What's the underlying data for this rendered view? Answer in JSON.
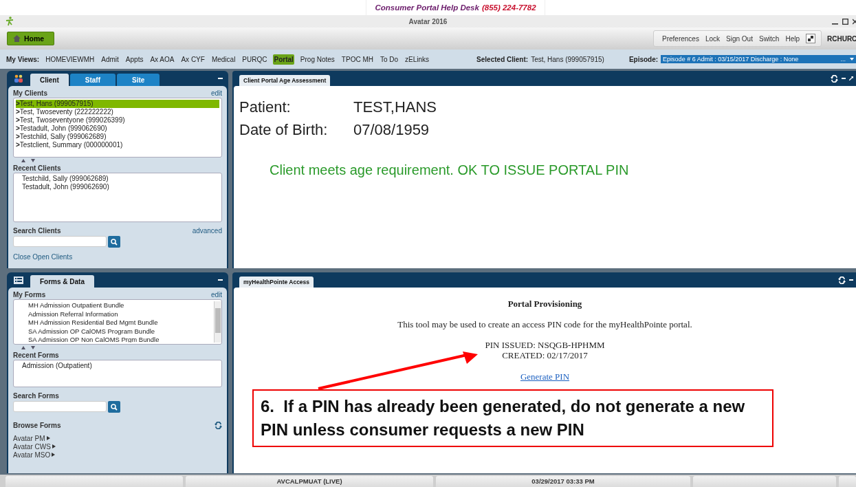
{
  "help_banner": {
    "label": "Consumer Portal Help Desk",
    "phone": "(855) 224-7782"
  },
  "window": {
    "title": "Avatar 2016"
  },
  "toolbar": {
    "home": "Home",
    "links": [
      "Preferences",
      "Lock",
      "Sign Out",
      "Switch",
      "Help"
    ],
    "user": "RCHURC"
  },
  "views_bar": {
    "label": "My Views:",
    "views": [
      {
        "label": "HOMEVIEWMH",
        "selected": false
      },
      {
        "label": "Admit",
        "selected": false
      },
      {
        "label": "Appts",
        "selected": false
      },
      {
        "label": "Ax AOA",
        "selected": false
      },
      {
        "label": "Ax CYF",
        "selected": false
      },
      {
        "label": "Medical",
        "selected": false
      },
      {
        "label": "PURQC",
        "selected": false
      },
      {
        "label": "Portal",
        "selected": true
      },
      {
        "label": "Prog Notes",
        "selected": false
      },
      {
        "label": "TPOC MH",
        "selected": false
      },
      {
        "label": "To Do",
        "selected": false
      },
      {
        "label": "zELinks",
        "selected": false
      }
    ],
    "selected_client_label": "Selected Client:",
    "selected_client": "Test, Hans (999057915)",
    "episode_label": "Episode:",
    "episode": "Episode # 6 Admit : 03/15/2017 Discharge : None",
    "episode_more": "..."
  },
  "client_panel": {
    "tabs": [
      {
        "label": "Client",
        "selected": true
      },
      {
        "label": "Staff",
        "selected": false
      },
      {
        "label": "Site",
        "selected": false
      }
    ],
    "my_clients": {
      "title": "My Clients",
      "edit": "edit",
      "items": [
        {
          "label": "**>**Test, Hans (999057915)",
          "selected": true
        },
        {
          "label": "**>**Test, Twoseventy (222222222)",
          "selected": false
        },
        {
          "label": "**>**Test, Twoseventyone (999026399)",
          "selected": false
        },
        {
          "label": "**>**Testadult, John (999062690)",
          "selected": false
        },
        {
          "label": "**>**Testchild, Sally (999062689)",
          "selected": false
        },
        {
          "label": "**>**Testclient, Summary (000000001)",
          "selected": false
        }
      ]
    },
    "recent_clients": {
      "title": "Recent Clients",
      "items": [
        "Testchild, Sally (999062689)",
        "Testadult, John (999062690)"
      ]
    },
    "search": {
      "title": "Search Clients",
      "advanced": "advanced"
    },
    "close_link": "Close Open Clients"
  },
  "forms_panel": {
    "tab": "Forms & Data",
    "my_forms": {
      "title": "My Forms",
      "edit": "edit",
      "items": [
        "MH Admission Outpatient Bundle",
        "Admission Referral Information",
        "MH Admission Residential Bed Mgmt Bundle",
        "SA Admission OP CalOMS Program Bundle",
        "SA Admission OP Non CalOMS Prgm Bundle"
      ]
    },
    "recent_forms": {
      "title": "Recent Forms",
      "items": [
        "Admission (Outpatient)"
      ]
    },
    "search": {
      "title": "Search Forms"
    },
    "browse": {
      "title": "Browse Forms",
      "items": [
        "Avatar PM",
        "Avatar CWS",
        "Avatar MSO"
      ]
    }
  },
  "age_panel": {
    "tab": "Client Portal Age Assessment",
    "fields": [
      {
        "label": "Patient:",
        "value": "TEST,HANS"
      },
      {
        "label": "Date of Birth:",
        "value": "07/08/1959"
      }
    ],
    "message": "Client meets age requirement. OK TO ISSUE PORTAL PIN"
  },
  "access_panel": {
    "tab": "myHealthPointe Access",
    "heading": "Portal Provisioning",
    "description": "This tool may be used to create an access PIN code for the myHealthPointe portal.",
    "pin_issued": "PIN ISSUED: NSQGB-HPHMM",
    "created": "CREATED: 02/17/2017",
    "link": "Generate PIN"
  },
  "callout": {
    "text": "6.  If a PIN has already been generated, do not generate a new PIN unless consumer requests a new PIN"
  },
  "status_bar": {
    "server": "AVCALPMUAT (LIVE)",
    "datetime": "03/29/2017 03:33 PM"
  }
}
